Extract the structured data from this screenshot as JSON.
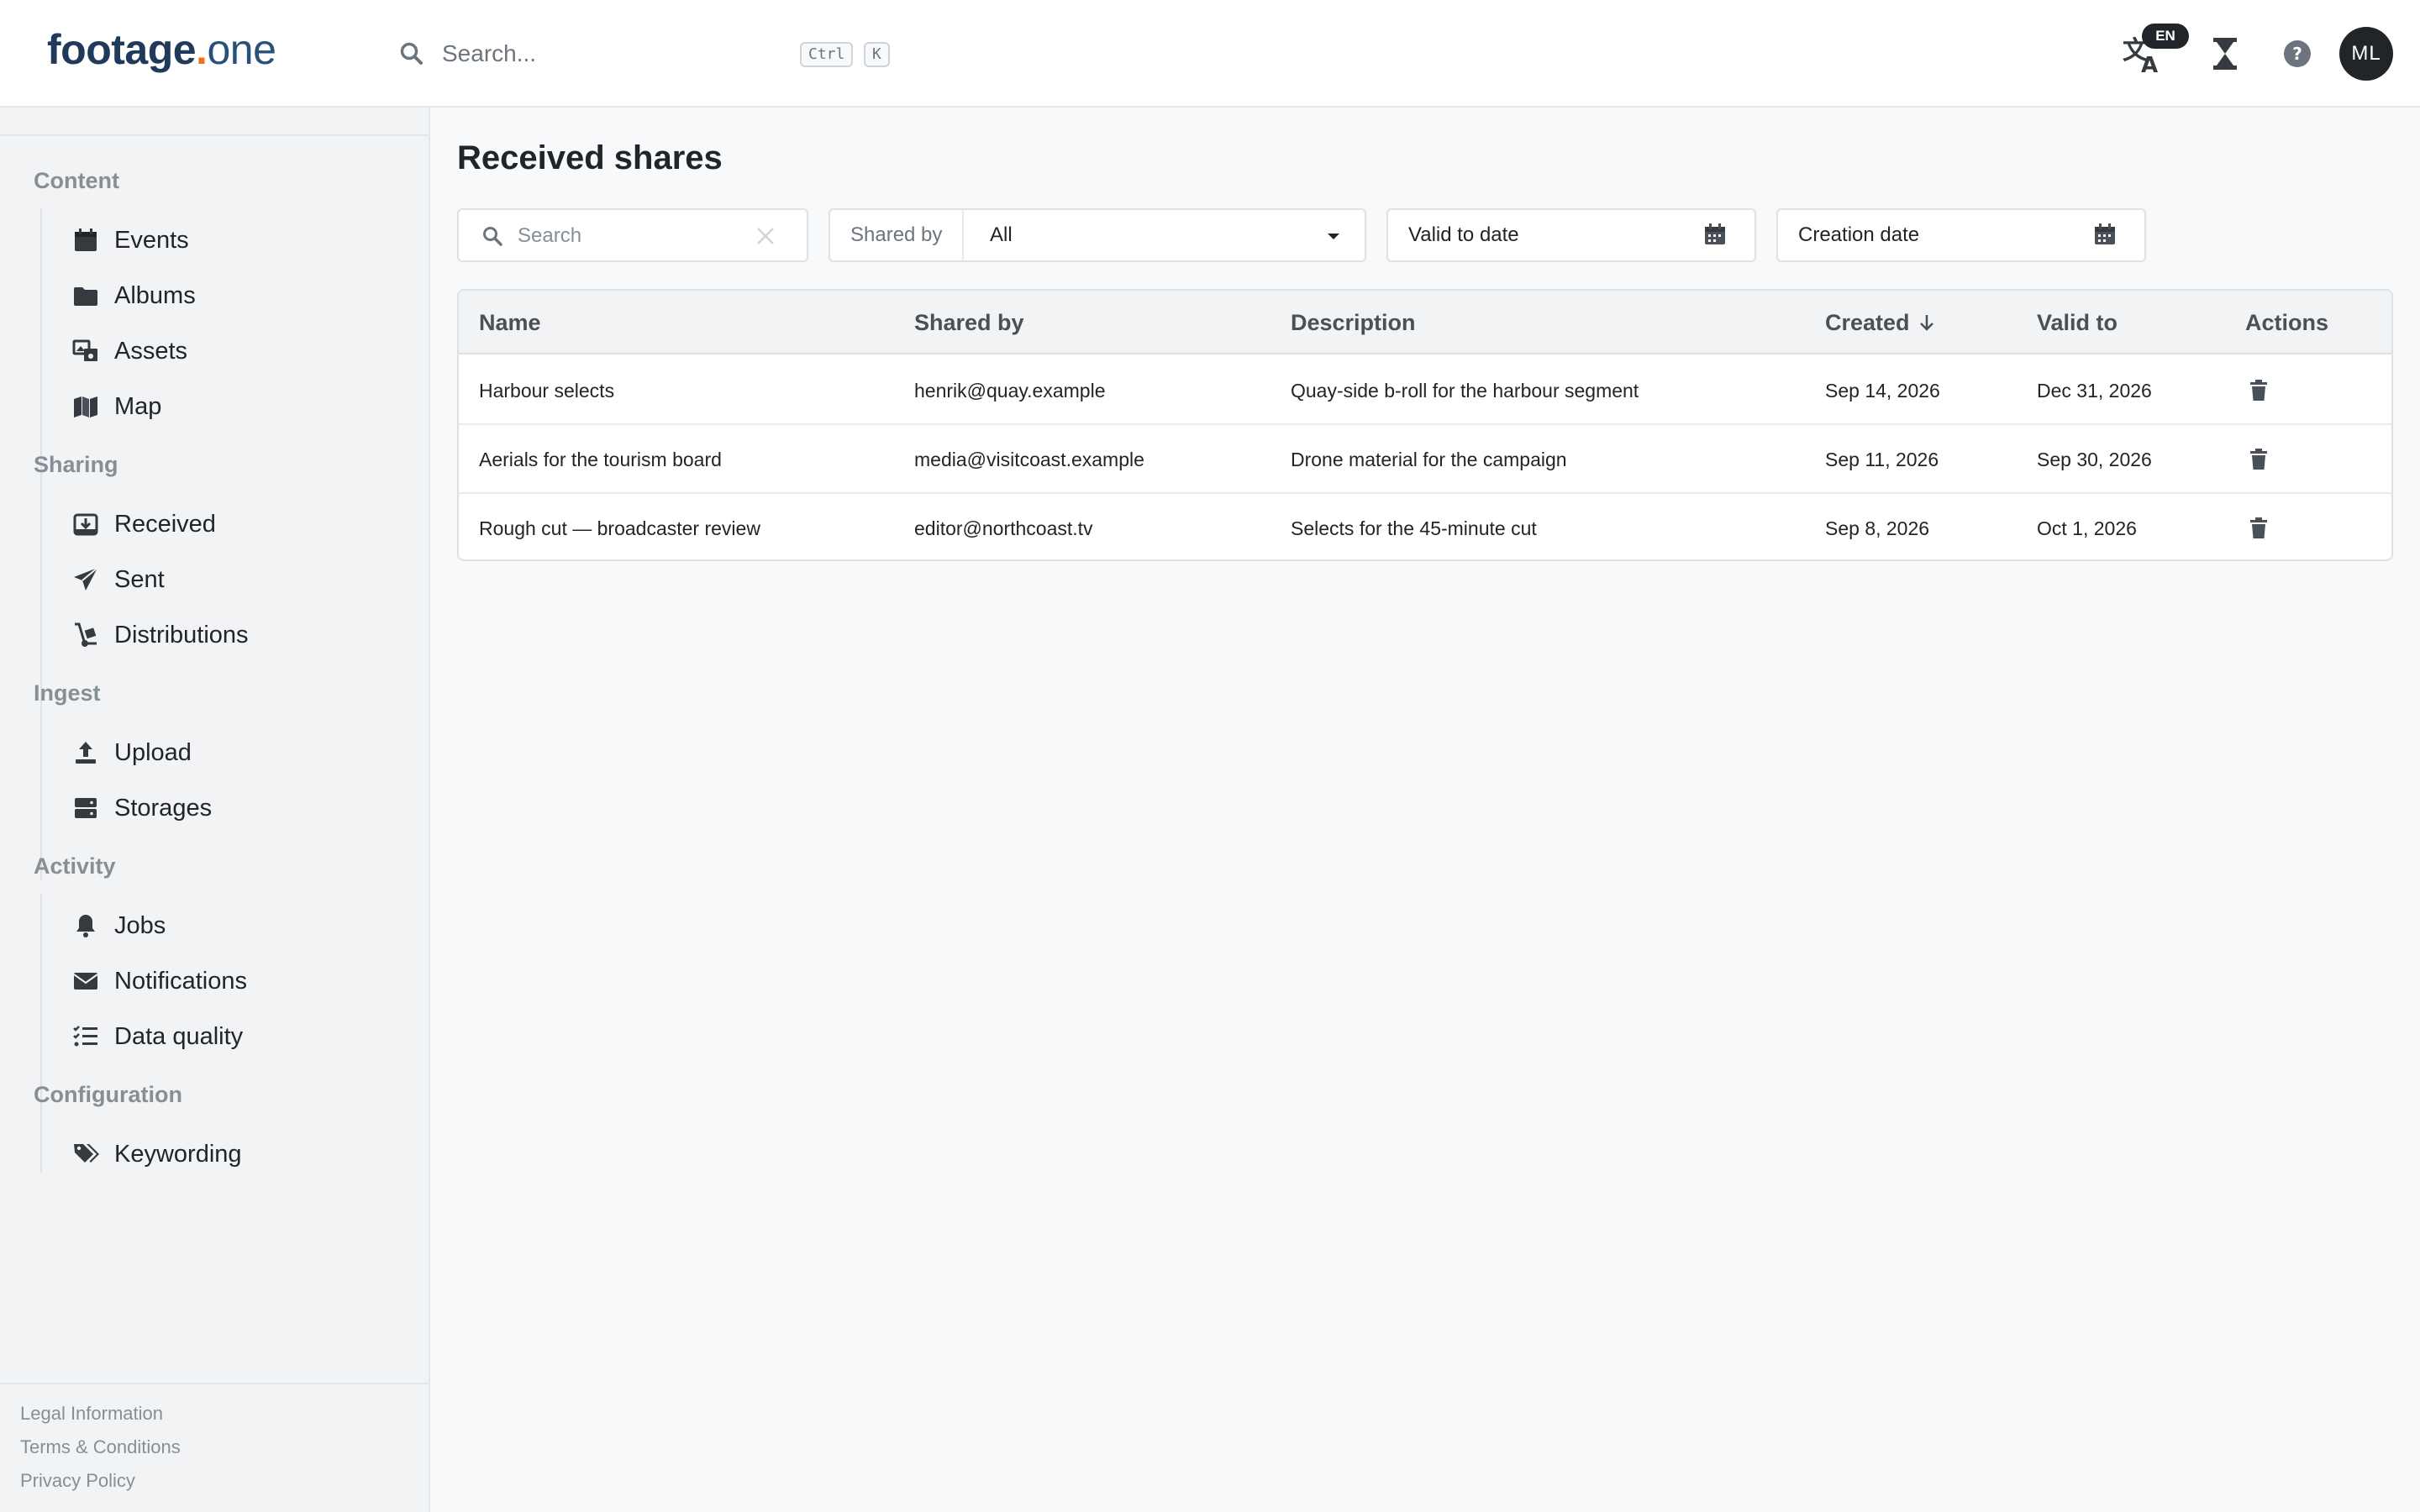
{
  "header": {
    "logo": {
      "part1": "footage",
      "dot": ".",
      "part2": "one"
    },
    "search": {
      "placeholder": "Search...",
      "shortcut_ctrl": "Ctrl",
      "shortcut_key": "K"
    },
    "language_badge": "EN",
    "avatar_initials": "ML"
  },
  "sidebar": {
    "sections": [
      {
        "title": "Content",
        "items": [
          {
            "label": "Events",
            "icon": "calendar-icon"
          },
          {
            "label": "Albums",
            "icon": "folder-icon"
          },
          {
            "label": "Assets",
            "icon": "media-assets-icon"
          },
          {
            "label": "Map",
            "icon": "map-icon"
          }
        ]
      },
      {
        "title": "Sharing",
        "items": [
          {
            "label": "Received",
            "icon": "inbox-download-icon"
          },
          {
            "label": "Sent",
            "icon": "paper-plane-icon"
          },
          {
            "label": "Distributions",
            "icon": "dolly-icon"
          }
        ]
      },
      {
        "title": "Ingest",
        "items": [
          {
            "label": "Upload",
            "icon": "upload-icon"
          },
          {
            "label": "Storages",
            "icon": "server-icon"
          }
        ]
      },
      {
        "title": "Activity",
        "items": [
          {
            "label": "Jobs",
            "icon": "bell-icon"
          },
          {
            "label": "Notifications",
            "icon": "envelope-icon"
          },
          {
            "label": "Data quality",
            "icon": "checklist-icon"
          }
        ]
      },
      {
        "title": "Configuration",
        "items": [
          {
            "label": "Keywording",
            "icon": "tags-icon"
          }
        ]
      }
    ],
    "footer_links": [
      "Legal Information",
      "Terms & Conditions",
      "Privacy Policy"
    ]
  },
  "main": {
    "title": "Received shares",
    "filters": {
      "search_placeholder": "Search",
      "shared_by_label": "Shared by",
      "shared_by_value": "All",
      "valid_to_placeholder": "Valid to date",
      "creation_placeholder": "Creation date"
    },
    "table": {
      "columns": [
        "Name",
        "Shared by",
        "Description",
        "Created",
        "Valid to",
        "Actions"
      ],
      "sorted_column": "Created",
      "sort_direction": "descending",
      "rows": [
        {
          "name": "Harbour selects",
          "shared_by": "henrik@quay.example",
          "description": "Quay-side b-roll for the harbour segment",
          "created": "Sep 14, 2026",
          "valid_to": "Dec 31, 2026"
        },
        {
          "name": "Aerials for the tourism board",
          "shared_by": "media@visitcoast.example",
          "description": "Drone material for the campaign",
          "created": "Sep 11, 2026",
          "valid_to": "Sep 30, 2026"
        },
        {
          "name": "Rough cut — broadcaster review",
          "shared_by": "editor@northcoast.tv",
          "description": "Selects for the 45-minute cut",
          "created": "Sep 8, 2026",
          "valid_to": "Oct 1, 2026"
        }
      ]
    }
  },
  "colors": {
    "brand_navy": "#1f3a5a",
    "brand_orange": "#e8731a",
    "sidebar_bg": "#f1f3f5",
    "text": "#212529"
  }
}
